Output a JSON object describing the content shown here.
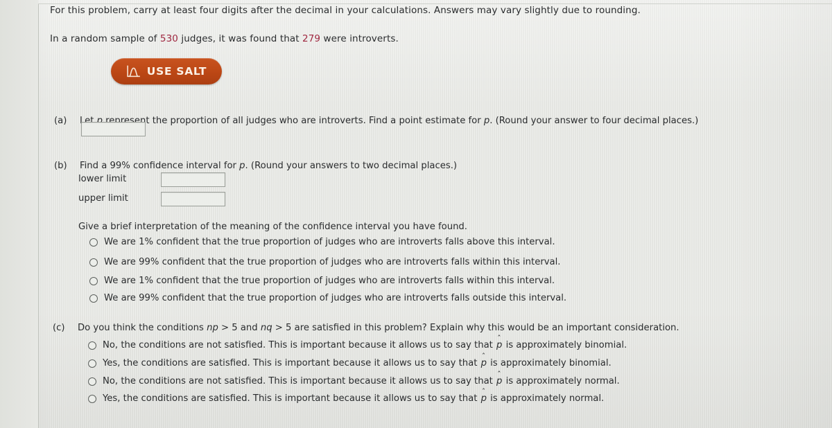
{
  "instructions": {
    "line1": "For this problem, carry at least four digits after the decimal in your calculations. Answers may vary slightly due to rounding.",
    "line2_pre": "In a random sample of ",
    "sample_size": "530",
    "line2_mid": " judges, it was found that ",
    "successes": "279",
    "line2_post": " were introverts."
  },
  "salt_button": {
    "label": "USE SALT",
    "icon": "normal-distribution-curve-icon",
    "background_color": "#bc4715",
    "text_color": "#fbf0e6"
  },
  "colors": {
    "page_background": "#e7e8e4",
    "text": "#2a2c2e",
    "highlight_number": "#9f2740",
    "input_border": "#9a9e98",
    "rule": "#c2c5bf"
  },
  "parts": {
    "a": {
      "letter": "(a)",
      "text_pre": "Let ",
      "var1": "p",
      "text_mid": " represent the proportion of all judges who are introverts. Find a point estimate for ",
      "var2": "p",
      "text_post": ". (Round your answer to four decimal places.)",
      "answer_value": "",
      "answer_placeholder": ""
    },
    "b": {
      "letter": "(b)",
      "text_pre": "Find a 99% confidence interval for ",
      "var1": "p",
      "text_post": ". (Round your answers to two decimal places.)",
      "lower_limit_label": "lower limit",
      "lower_limit_value": "",
      "upper_limit_label": "upper limit",
      "upper_limit_value": "",
      "prompt": "Give a brief interpretation of the meaning of the confidence interval you have found.",
      "options": [
        "We are 1% confident that the true proportion of judges who are introverts falls above this interval.",
        "We are 99% confident that the true proportion of judges who are introverts falls within this interval.",
        "We are 1% confident that the true proportion of judges who are introverts falls within this interval.",
        "We are 99% confident that the true proportion of judges who are introverts falls outside this interval."
      ],
      "selected_option": null
    },
    "c": {
      "letter": "(c)",
      "text_pre": "Do you think the conditions ",
      "var1": "np",
      "text_mid1": " > 5 and ",
      "var2": "nq",
      "text_post": " > 5 are satisfied in this problem? Explain why this would be an important consideration.",
      "options": [
        {
          "pre": "No, the conditions are not satisfied. This is important because it allows us to say that ",
          "symbol": "p",
          "post": " is approximately binomial."
        },
        {
          "pre": "Yes, the conditions are satisfied. This is important because it allows us to say that ",
          "symbol": "p",
          "post": " is approximately binomial."
        },
        {
          "pre": "No, the conditions are not satisfied. This is important because it allows us to say that ",
          "symbol": "p",
          "post": " is approximately normal."
        },
        {
          "pre": "Yes, the conditions are satisfied. This is important because it allows us to say that ",
          "symbol": "p",
          "post": " is approximately normal."
        }
      ],
      "selected_option": null
    }
  }
}
